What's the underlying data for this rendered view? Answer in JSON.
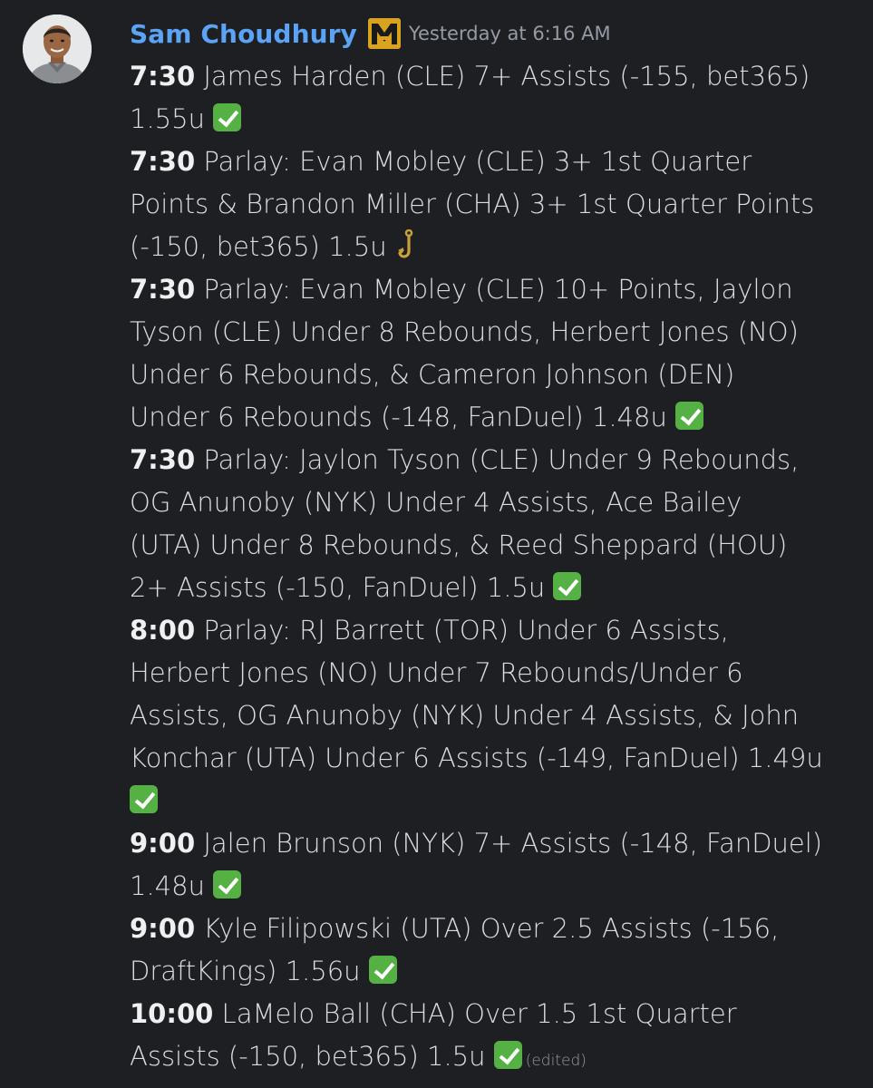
{
  "message": {
    "author": "Sam Choudhury",
    "timestamp": "Yesterday at 6:16 AM",
    "edited_label": "(edited)",
    "author_color": "#5aa3f5",
    "role_icon": "crown-badge-icon",
    "lines": [
      {
        "time": "7:30",
        "text": " James Harden (CLE) 7+ Assists (-155, bet365)\n1.55u ",
        "status_icon": "check-mark-icon"
      },
      {
        "time": "7:30",
        "text": " Parlay: Evan Mobley (CLE) 3+ 1st Quarter\nPoints & Brandon Miller (CHA) 3+ 1st Quarter Points\n(-150, bet365) 1.5u ",
        "status_icon": "hook-icon"
      },
      {
        "time": "7:30",
        "text": " Parlay: Evan Mobley (CLE) 10+ Points, Jaylon\nTyson (CLE) Under 8 Rebounds, Herbert Jones (NO)\nUnder 6 Rebounds, & Cameron Johnson (DEN)\nUnder 6 Rebounds (-148, FanDuel) 1.48u ",
        "status_icon": "check-mark-icon"
      },
      {
        "time": "7:30",
        "text": " Parlay: Jaylon Tyson (CLE) Under 9 Rebounds,\nOG Anunoby (NYK) Under 4 Assists, Ace Bailey\n(UTA) Under 8 Rebounds, & Reed Sheppard (HOU)\n2+ Assists (-150, FanDuel) 1.5u ",
        "status_icon": "check-mark-icon"
      },
      {
        "time": "8:00",
        "text": " Parlay: RJ Barrett (TOR) Under 6 Assists,\nHerbert Jones (NO) Under 7 Rebounds/Under 6\nAssists, OG Anunoby (NYK) Under 4 Assists, & John\nKonchar (UTA) Under 6 Assists (-149, FanDuel) 1.49u\n",
        "status_icon": "check-mark-icon"
      },
      {
        "time": "9:00",
        "text": " Jalen Brunson (NYK) 7+ Assists (-148, FanDuel)\n1.48u ",
        "status_icon": "check-mark-icon"
      },
      {
        "time": "9:00",
        "text": " Kyle Filipowski (UTA) Over 2.5 Assists (-156,\nDraftKings) 1.56u ",
        "status_icon": "check-mark-icon"
      },
      {
        "time": "10:00",
        "text": " LaMelo Ball (CHA) Over 1.5 1st Quarter\nAssists (-150, bet365) 1.5u ",
        "status_icon": "check-mark-icon"
      }
    ]
  }
}
